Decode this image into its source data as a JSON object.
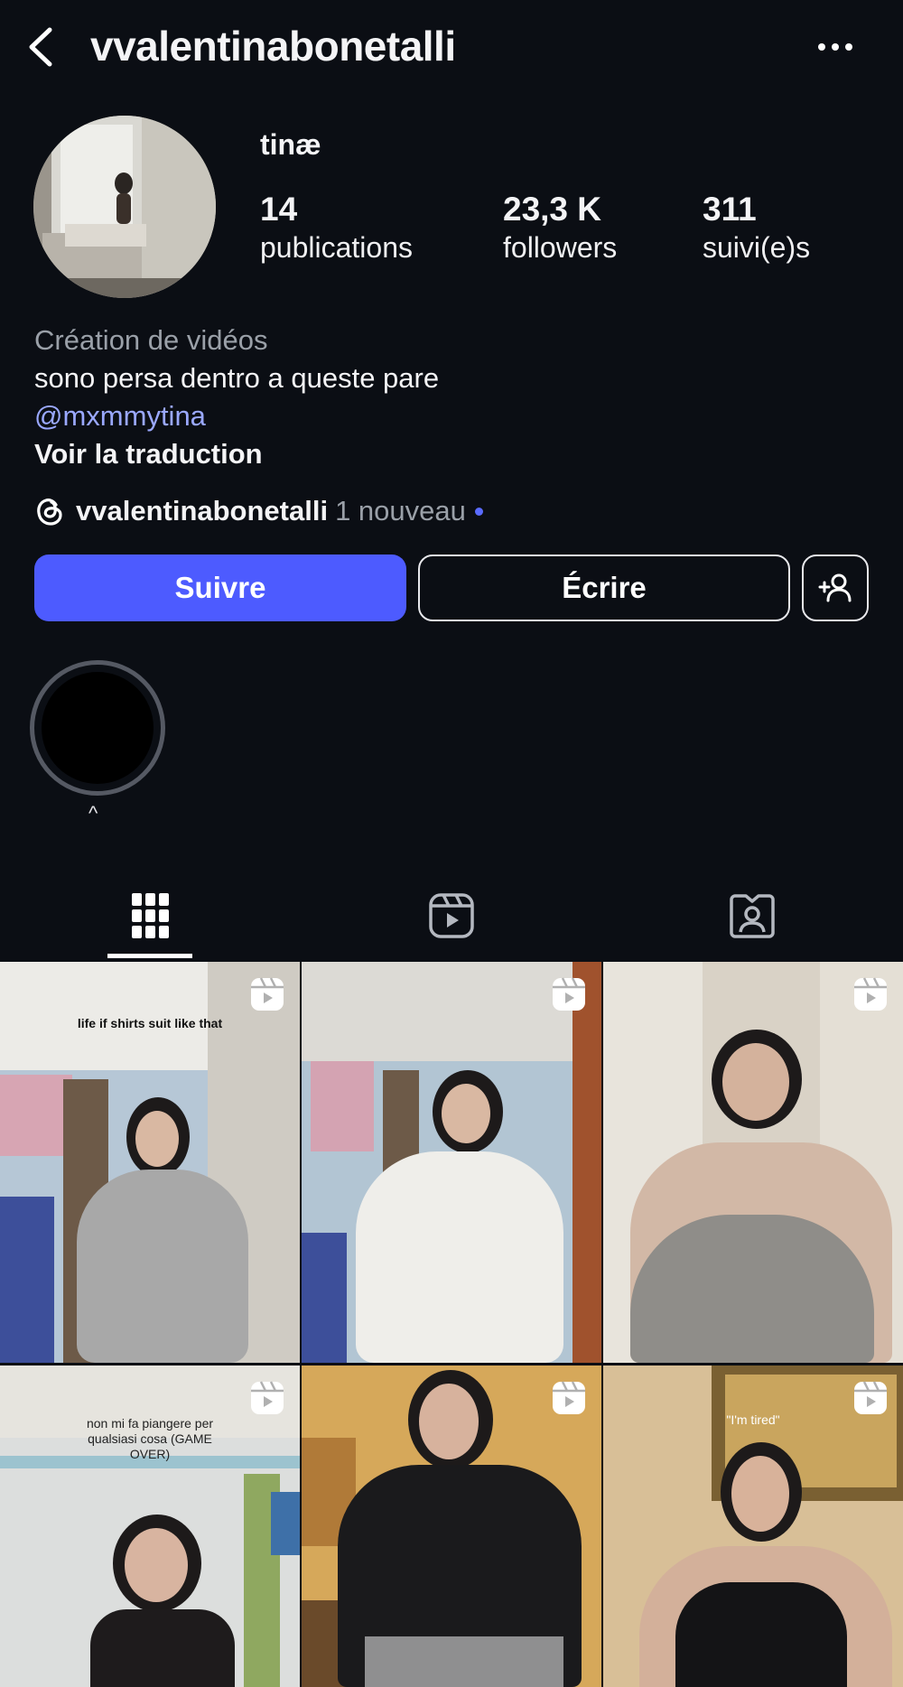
{
  "header": {
    "username": "vvalentinabonetalli"
  },
  "profile": {
    "display_name": "tinæ",
    "stats": [
      {
        "value": "14",
        "label": "publications"
      },
      {
        "value": "23,3 K",
        "label": "followers"
      },
      {
        "value": "311",
        "label": "suivi(e)s"
      }
    ],
    "bio": {
      "category": "Création de vidéos",
      "text": "sono persa dentro a queste pare",
      "mention": "@mxmmytina",
      "translate": "Voir la traduction"
    },
    "threads": {
      "name": "vvalentinabonetalli",
      "badge": "1 nouveau"
    }
  },
  "actions": {
    "follow": "Suivre",
    "message": "Écrire"
  },
  "highlight": {
    "label": "^"
  },
  "tabs": [
    {
      "icon": "grid-icon",
      "active": true
    },
    {
      "icon": "reels-icon",
      "active": false
    },
    {
      "icon": "tagged-icon",
      "active": false
    }
  ],
  "posts": [
    {
      "type": "reel",
      "caption": "life if shirts suit like that"
    },
    {
      "type": "reel",
      "caption": ""
    },
    {
      "type": "reel",
      "caption": ""
    },
    {
      "type": "reel",
      "caption": "non mi fa piangere per qualsiasi cosa (GAME OVER)"
    },
    {
      "type": "reel",
      "caption": ""
    },
    {
      "type": "reel",
      "caption": "\"I'm tired\""
    }
  ],
  "colors": {
    "background": "#0b0e14",
    "accent": "#4d5bff",
    "link": "#9aa8ff",
    "muted": "#9aa0a8"
  }
}
